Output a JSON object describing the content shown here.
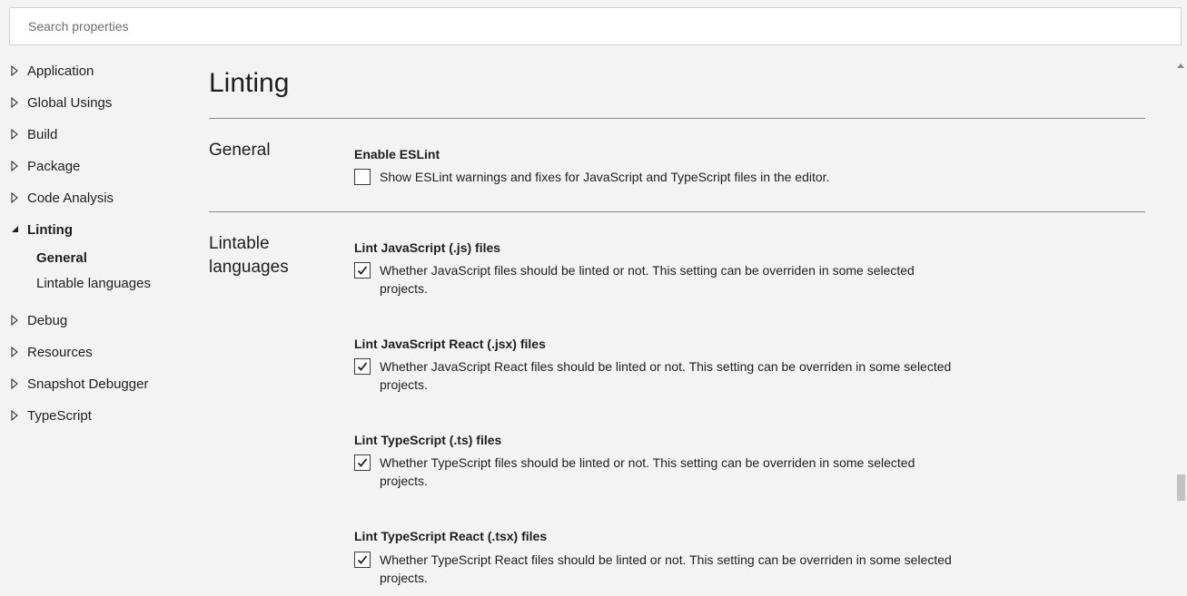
{
  "search": {
    "placeholder": "Search properties"
  },
  "nav": {
    "items": [
      {
        "label": "Application"
      },
      {
        "label": "Global Usings"
      },
      {
        "label": "Build"
      },
      {
        "label": "Package"
      },
      {
        "label": "Code Analysis"
      },
      {
        "label": "Linting",
        "expanded": true
      },
      {
        "label": "Debug"
      },
      {
        "label": "Resources"
      },
      {
        "label": "Snapshot Debugger"
      },
      {
        "label": "TypeScript"
      }
    ],
    "sub": [
      {
        "label": "General",
        "active": true
      },
      {
        "label": "Lintable languages"
      }
    ]
  },
  "page": {
    "title": "Linting"
  },
  "sections": {
    "general": {
      "title": "General",
      "settings": [
        {
          "title": "Enable ESLint",
          "desc": "Show ESLint warnings and fixes for JavaScript and TypeScript files in the editor.",
          "checked": false
        }
      ]
    },
    "lintable": {
      "title": "Lintable languages",
      "settings": [
        {
          "title": "Lint JavaScript (.js) files",
          "desc": "Whether JavaScript files should be linted or not. This setting can be overriden in some selected projects.",
          "checked": true
        },
        {
          "title": "Lint JavaScript React (.jsx) files",
          "desc": "Whether JavaScript React files should be linted or not. This setting can be overriden in some selected projects.",
          "checked": true
        },
        {
          "title": "Lint TypeScript (.ts) files",
          "desc": "Whether TypeScript files should be linted or not. This setting can be overriden in some selected projects.",
          "checked": true
        },
        {
          "title": "Lint TypeScript React (.tsx) files",
          "desc": "Whether TypeScript React files should be linted or not. This setting can be overriden in some selected projects.",
          "checked": true
        }
      ]
    }
  }
}
